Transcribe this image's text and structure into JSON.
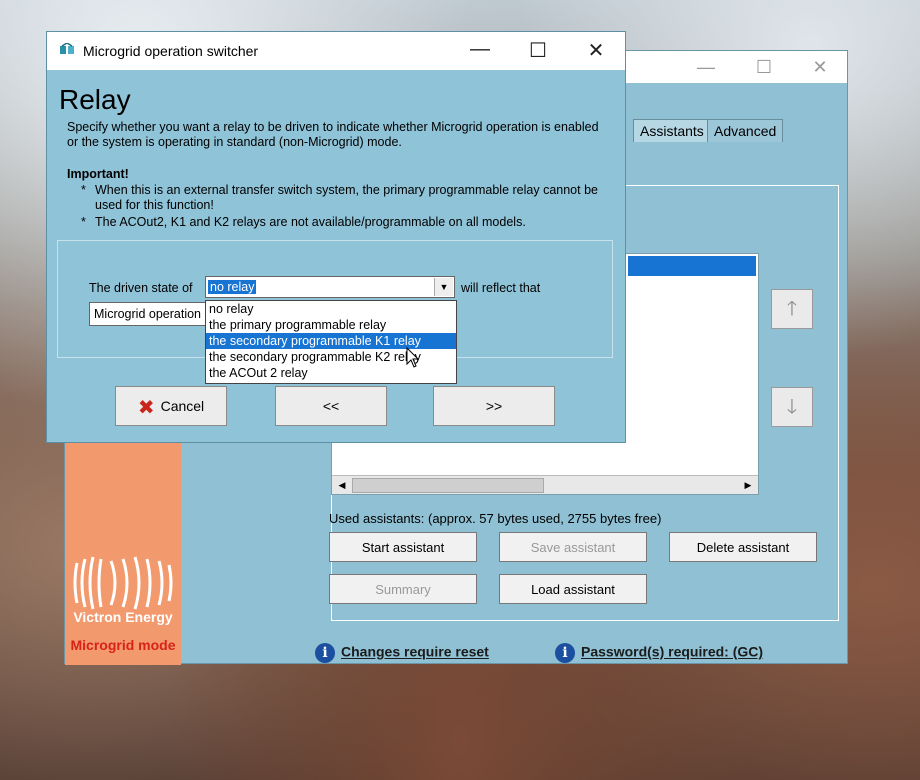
{
  "main_window": {
    "tabs": [
      "Assistants",
      "Advanced"
    ],
    "used_text": "Used assistants: (approx. 57 bytes used, 2755 bytes free)",
    "buttons": {
      "start": "Start assistant",
      "save": "Save assistant",
      "delete": "Delete assistant",
      "summary": "Summary",
      "load": "Load assistant"
    },
    "logo_text": "Victron Energy",
    "mode_text": "Microgrid mode",
    "status": {
      "reset": "Changes require reset",
      "password": "Password(s) required: (GC)"
    }
  },
  "dialog": {
    "title": "Microgrid operation switcher",
    "heading": "Relay",
    "description": "Specify whether you want a relay to be driven to indicate whether Microgrid operation is enabled or the system is operating in standard (non-Microgrid) mode.",
    "important_label": "Important!",
    "bullets": [
      "When this is an external transfer switch system, the primary programmable relay cannot be used for this function!",
      "The ACOut2, K1 and K2 relays are not available/programmable on all models."
    ],
    "driven_label": "The driven state of",
    "selected_relay": "no relay",
    "reflect_label": "will reflect that",
    "second_value": "Microgrid operation",
    "dropdown_options": [
      "no relay",
      "the primary programmable relay",
      "the secondary programmable K1 relay",
      "the secondary programmable K2 relay",
      "the ACOut 2 relay"
    ],
    "highlighted_option_index": 2,
    "buttons": {
      "cancel": "Cancel",
      "back": "<<",
      "next": ">>"
    }
  }
}
